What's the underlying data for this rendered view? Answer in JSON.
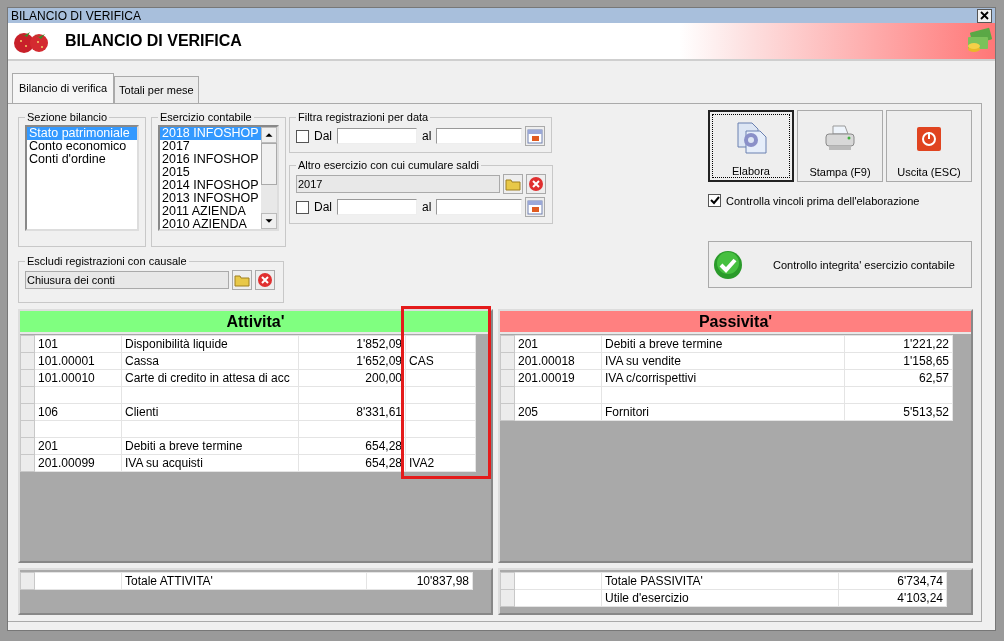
{
  "window": {
    "title": "BILANCIO DI VERIFICA"
  },
  "header": {
    "title": "BILANCIO DI VERIFICA"
  },
  "tabs": [
    {
      "label": "Bilancio di verifica",
      "selected": true
    },
    {
      "label": "Totali per mese",
      "selected": false
    }
  ],
  "sezione_bilancio": {
    "label": "Sezione bilancio",
    "items": [
      {
        "label": "Stato patrimoniale",
        "selected": true
      },
      {
        "label": "Conto economico",
        "selected": false
      },
      {
        "label": "Conti d'ordine",
        "selected": false
      }
    ]
  },
  "esercizio_contabile": {
    "label": "Esercizio contabile",
    "items": [
      {
        "label": "2018 INFOSHOP",
        "selected": true
      },
      {
        "label": "2017",
        "selected": false
      },
      {
        "label": "2016 INFOSHOP",
        "selected": false
      },
      {
        "label": "2015",
        "selected": false
      },
      {
        "label": "2014 INFOSHOP",
        "selected": false
      },
      {
        "label": "2013 INFOSHOP",
        "selected": false
      },
      {
        "label": "2011 AZIENDA",
        "selected": false
      },
      {
        "label": "2010 AZIENDA",
        "selected": false
      }
    ]
  },
  "filtra_data": {
    "label": "Filtra registrazioni per data",
    "checked": false,
    "from_label": "Dal",
    "to_label": "al"
  },
  "altro_esercizio": {
    "label": "Altro esercizio con cui cumulare saldi",
    "value": "2017",
    "checked": false,
    "from_label": "Dal",
    "to_label": "al"
  },
  "escludi_causale": {
    "label": "Escludi registrazioni con causale",
    "value": "Chiusura dei conti"
  },
  "buttons": [
    {
      "label": "Elabora",
      "kind": "process",
      "focused": true
    },
    {
      "label": "Stampa (F9)",
      "kind": "print",
      "focused": false
    },
    {
      "label": "Uscita (ESC)",
      "kind": "exit",
      "focused": false
    }
  ],
  "controlla_vincoli": {
    "label": "Controlla vincoli prima dell'elaborazione",
    "checked": true
  },
  "controllo_button": {
    "label": "Controllo integrita' esercizio contabile"
  },
  "attivita": {
    "title": "Attivita'",
    "rows": [
      {
        "kind": "account",
        "code": "101",
        "description": "Disponibilità liquide",
        "amount": "1'852,09"
      },
      {
        "kind": "account",
        "code": "101.00001",
        "description": "Cassa",
        "amount": "1'652,09",
        "code_2": "CAS"
      },
      {
        "kind": "account",
        "code": "101.00010",
        "description": "Carte di credito in attesa di acc",
        "amount": "200,00"
      },
      {
        "kind": "blank"
      },
      {
        "kind": "account",
        "code": "106",
        "description": "Clienti",
        "amount": "8'331,61"
      },
      {
        "kind": "blank"
      },
      {
        "kind": "account",
        "code": "201",
        "description": "Debiti a breve termine",
        "amount": "654,28"
      },
      {
        "kind": "account",
        "code": "201.00099",
        "description": "IVA su acquisti",
        "amount": "654,28",
        "code_2": "IVA2"
      }
    ]
  },
  "passivita": {
    "title": "Passivita'",
    "rows": [
      {
        "kind": "account",
        "code": "201",
        "description": "Debiti a breve termine",
        "amount": "1'221,22"
      },
      {
        "kind": "account",
        "code": "201.00018",
        "description": "IVA su vendite",
        "amount": "1'158,65"
      },
      {
        "kind": "account",
        "code": "201.00019",
        "description": "IVA c/corrispettivi",
        "amount": "62,57"
      },
      {
        "kind": "blank"
      },
      {
        "kind": "account",
        "code": "205",
        "description": "Fornitori",
        "amount": "5'513,52"
      }
    ]
  },
  "totali_attivita": [
    {
      "label": "Totale ATTIVITA'",
      "amount": "10'837,98"
    }
  ],
  "totali_passivita": [
    {
      "label": "Totale PASSIVITA'",
      "amount": "6'734,74"
    },
    {
      "label": "Utile d'esercizio",
      "amount": "4'103,24"
    }
  ]
}
